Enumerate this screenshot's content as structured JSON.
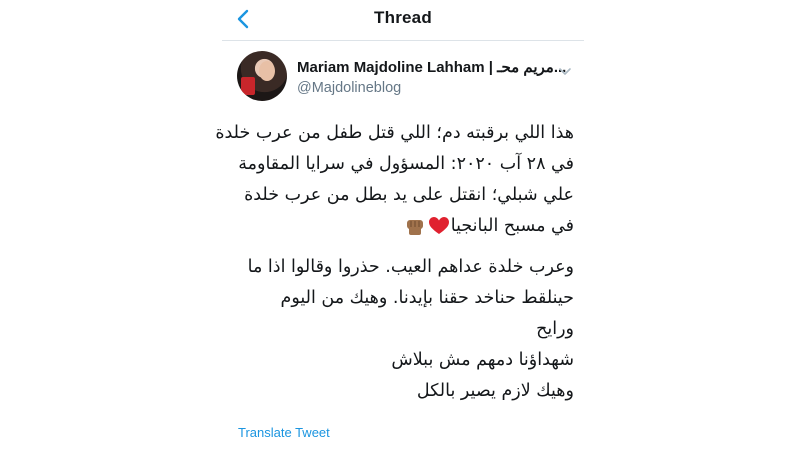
{
  "header": {
    "title": "Thread",
    "back_icon": "chevron-left-icon",
    "accent_color": "#1b95e0"
  },
  "author": {
    "name": "Mariam Majdoline Lahham | مريم محـ...",
    "handle": "@Majdolineblog",
    "avatar_icon": "avatar",
    "menu_icon": "chevron-down-icon"
  },
  "tweet": {
    "paragraph_1": {
      "line_1": "هذا اللي برقبته دم؛ اللي قتل طفل من عرب خلدة",
      "line_2": "في ٢٨ آب ٢٠٢٠: المسؤول في سرايا المقاومة",
      "line_3": "علي شبلي؛ انقتل على يد بطل من عرب خلدة",
      "line_4": "في مسبح البانجيا"
    },
    "emojis": [
      "red-heart-icon",
      "raised-fist-icon"
    ],
    "paragraph_2": {
      "line_1": "وعرب خلدة عداهم العيب. حذروا وقالوا اذا ما",
      "line_2": "حينلقط حناخد حقنا بإيدنا. وهيك من اليوم",
      "line_3": "ورايح",
      "line_4": "شهداؤنا دمهم مش ببلاش",
      "line_5": "وهيك لازم يصير بالكل"
    }
  },
  "translate": {
    "label": "Translate Tweet"
  }
}
